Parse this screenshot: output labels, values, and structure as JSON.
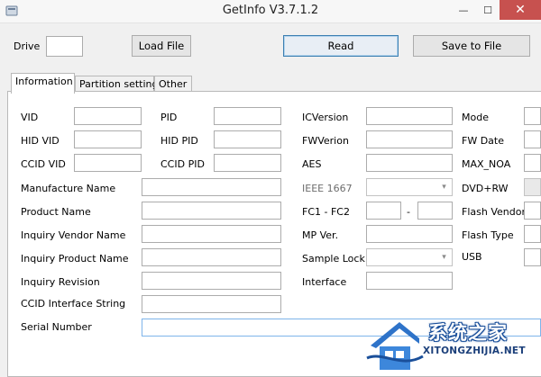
{
  "window": {
    "title": "GetInfo V3.7.1.2",
    "minimize_glyph": "—",
    "maximize_glyph": "☐",
    "close_glyph": "✕"
  },
  "toolbar": {
    "drive_label": "Drive",
    "drive_value": "",
    "load_file_label": "Load File",
    "read_label": "Read",
    "save_to_file_label": "Save to File"
  },
  "tabs": [
    {
      "label": "Information",
      "active": true
    },
    {
      "label": "Partition setting",
      "active": false
    },
    {
      "label": "Other",
      "active": false
    }
  ],
  "info": {
    "vid": {
      "label": "VID",
      "value": ""
    },
    "pid": {
      "label": "PID",
      "value": ""
    },
    "hid_vid": {
      "label": "HID VID",
      "value": ""
    },
    "hid_pid": {
      "label": "HID PID",
      "value": ""
    },
    "ccid_vid": {
      "label": "CCID VID",
      "value": ""
    },
    "ccid_pid": {
      "label": "CCID PID",
      "value": ""
    },
    "manufacture_name": {
      "label": "Manufacture Name",
      "value": ""
    },
    "product_name": {
      "label": "Product Name",
      "value": ""
    },
    "inquiry_vendor_name": {
      "label": "Inquiry Vendor Name",
      "value": ""
    },
    "inquiry_product_name": {
      "label": "Inquiry Product Name",
      "value": ""
    },
    "inquiry_revision": {
      "label": "Inquiry Revision",
      "value": ""
    },
    "ccid_interface_string": {
      "label": "CCID Interface String",
      "value": ""
    },
    "serial_number": {
      "label": "Serial Number",
      "value": ""
    },
    "ic_version": {
      "label": "ICVersion",
      "value": ""
    },
    "fw_version": {
      "label": "FWVerion",
      "value": ""
    },
    "aes": {
      "label": "AES",
      "value": ""
    },
    "ieee1667": {
      "label": "IEEE 1667",
      "value": ""
    },
    "fc1_fc2": {
      "label": "FC1 - FC2",
      "value1": "",
      "separator": "-",
      "value2": ""
    },
    "mp_ver": {
      "label": "MP Ver.",
      "value": ""
    },
    "sample_lock": {
      "label": "Sample Lock",
      "value": ""
    },
    "interface": {
      "label": "Interface",
      "value": ""
    },
    "mode": {
      "label": "Mode",
      "value": ""
    },
    "fw_date": {
      "label": "FW Date",
      "value": ""
    },
    "max_noa": {
      "label": "MAX_NOA",
      "value": ""
    },
    "dvd_rw": {
      "label": "DVD+RW",
      "value": ""
    },
    "flash_vendor": {
      "label": "Flash Vendor",
      "value": ""
    },
    "flash_type": {
      "label": "Flash Type",
      "value": ""
    },
    "usb": {
      "label": "USB",
      "value": ""
    }
  },
  "watermark": {
    "text": "系统之家",
    "url": "XITONGZHIJIA.NET"
  },
  "colors": {
    "window_bg": "#f0f0f0",
    "close_button": "#c7514f",
    "field_border": "#acacac",
    "focus_border": "#7eb4ea",
    "watermark_blue": "#1a4f9a"
  }
}
